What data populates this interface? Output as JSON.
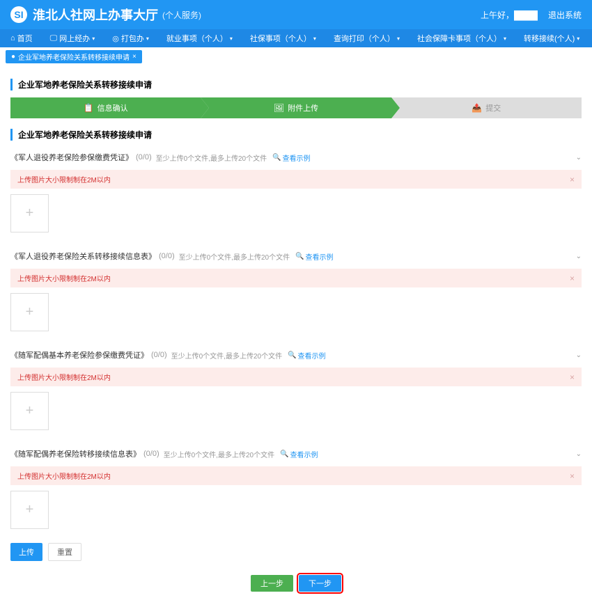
{
  "header": {
    "logo_text": "淮北人社网上办事大厅",
    "logo_sub": "(个人服务)",
    "greeting": "上午好，",
    "user_mask": "████",
    "logout": "退出系统"
  },
  "nav": {
    "home": "首页",
    "online": "网上经办",
    "packages": "打包办",
    "employment": "就业事项（个人）",
    "social": "社保事项（个人）",
    "query": "查询打印（个人）",
    "card": "社会保障卡事项（个人）",
    "transfer": "转移接续(个人)"
  },
  "breadcrumb": {
    "tag": "企业军地养老保险关系转移接续申请"
  },
  "page_title": "企业军地养老保险关系转移接续申请",
  "steps": {
    "s1": "信息确认",
    "s2": "附件上传",
    "s3": "提交"
  },
  "section_title2": "企业军地养老保险关系转移接续申请",
  "uploads": [
    {
      "title": "《军人退役养老保险参保缴费凭证》",
      "count": "(0/0)",
      "hint": "至少上传0个文件,最多上传20个文件",
      "example": "查看示例",
      "warning": "上传图片大小限制制在2M以内"
    },
    {
      "title": "《军人退役养老保险关系转移接续信息表》",
      "count": "(0/0)",
      "hint": "至少上传0个文件,最多上传20个文件",
      "example": "查看示例",
      "warning": "上传图片大小限制制在2M以内"
    },
    {
      "title": "《随军配偶基本养老保险参保缴费凭证》",
      "count": "(0/0)",
      "hint": "至少上传0个文件,最多上传20个文件",
      "example": "查看示例",
      "warning": "上传图片大小限制制在2M以内"
    },
    {
      "title": "《随军配偶养老保险转移接续信息表》",
      "count": "(0/0)",
      "hint": "至少上传0个文件,最多上传20个文件",
      "example": "查看示例",
      "warning": "上传图片大小限制制在2M以内"
    }
  ],
  "actions": {
    "upload": "上传",
    "reset": "重置",
    "prev": "上一步",
    "next": "下一步"
  }
}
